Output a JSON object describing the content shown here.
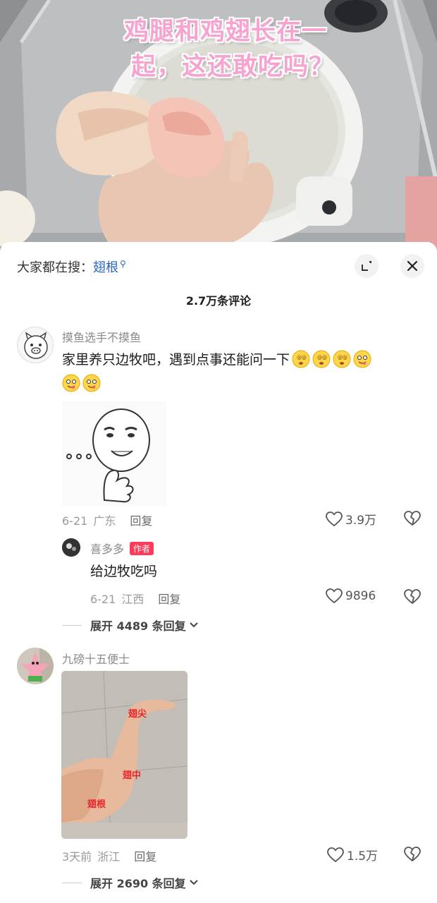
{
  "video": {
    "caption_line1": "鸡腿和鸡翅长在一",
    "caption_line2": "起，这还敢吃吗？",
    "caption_color": "#f7a3cf"
  },
  "sheet": {
    "search_prefix": "大家都在搜：",
    "search_keyword": "翅根",
    "search_keyword_color": "#2a66b8",
    "comment_count": "2.7万条评论",
    "expand_icon": "fullscreen-icon",
    "close_icon": "close-icon"
  },
  "comments": [
    {
      "username": "摸鱼选手不摸鱼",
      "text": "家里养只边牧吧，遇到点事还能问一下",
      "date": "6-21",
      "location": "广东",
      "reply_label": "回复",
      "likes": "3.9万",
      "attachment": "meme-sticker",
      "reply": {
        "username": "喜多多",
        "author_tag": "作者",
        "text": "给边牧吃吗",
        "date": "6-21",
        "location": "江西",
        "reply_label": "回复",
        "likes": "9896"
      },
      "expand_label": "展开 4489 条回复"
    },
    {
      "username": "九磅十五便士",
      "date": "3天前",
      "location": "浙江",
      "reply_label": "回复",
      "likes": "1.5万",
      "attachment": "arm-photo",
      "photo_labels": [
        "翅尖",
        "翅中",
        "翅根"
      ],
      "expand_label": "展开 2690 条回复"
    }
  ],
  "colors": {
    "author_tag": "#ff3b5c",
    "photo_label": "#e8262a"
  }
}
